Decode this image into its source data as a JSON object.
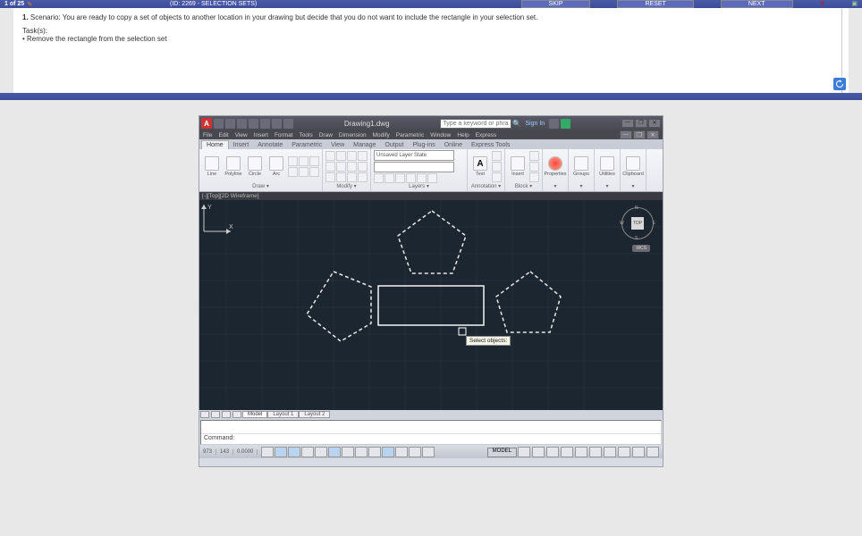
{
  "header": {
    "progress": "1 of 25",
    "title": "(ID: 2269 - SELECTION SETS)",
    "buttons": {
      "skip": "SKIP",
      "reset": "RESET",
      "next": "NEXT"
    }
  },
  "scenario": {
    "prefix": "1.",
    "label": "Scenario:",
    "text": "You are ready to copy a set of objects to another location in your drawing but decide that you do not want to include the rectangle in your selection set.",
    "tasks_label": "Task(s):",
    "tasks": [
      "• Remove the rectangle from the selection set"
    ]
  },
  "cad": {
    "filename": "Drawing1.dwg",
    "search_placeholder": "Type a keyword or phrase",
    "signin": "Sign In",
    "menubar": [
      "File",
      "Edit",
      "View",
      "Insert",
      "Format",
      "Tools",
      "Draw",
      "Dimension",
      "Modify",
      "Parametric",
      "Window",
      "Help",
      "Express"
    ],
    "tabs": [
      "Home",
      "Insert",
      "Annotate",
      "Parametric",
      "View",
      "Manage",
      "Output",
      "Plug-ins",
      "Online",
      "Express Tools"
    ],
    "ribbon": {
      "draw": {
        "label": "Draw ▾",
        "tools": [
          "Line",
          "Polyline",
          "Circle",
          "Arc"
        ]
      },
      "modify": {
        "label": "Modify ▾"
      },
      "layers": {
        "label": "Layers ▾",
        "state": "Unsaved Layer State"
      },
      "annotation": {
        "label": "Annotation ▾",
        "text": "Text"
      },
      "block": {
        "label": "Block ▾",
        "insert": "Insert"
      },
      "properties": {
        "label": "Properties"
      },
      "groups": {
        "label": "Groups"
      },
      "utilities": {
        "label": "Utilities"
      },
      "clipboard": {
        "label": "Clipboard"
      }
    },
    "viewport_label": "[-][Top][2D Wireframe]",
    "viewcube": {
      "face": "TOP",
      "n": "N",
      "s": "S",
      "e": "E",
      "w": "W"
    },
    "wcs": "WCS",
    "tooltip": "Select objects:",
    "ucs": {
      "x": "X",
      "y": "Y"
    },
    "layouts": {
      "model": "Model",
      "l1": "Layout 1",
      "l2": "Layout 2"
    },
    "command_prompt": "Command:",
    "status": {
      "coord1": "973",
      "coord2": "143",
      "coord3": "0.0000",
      "model": "MODEL"
    }
  }
}
